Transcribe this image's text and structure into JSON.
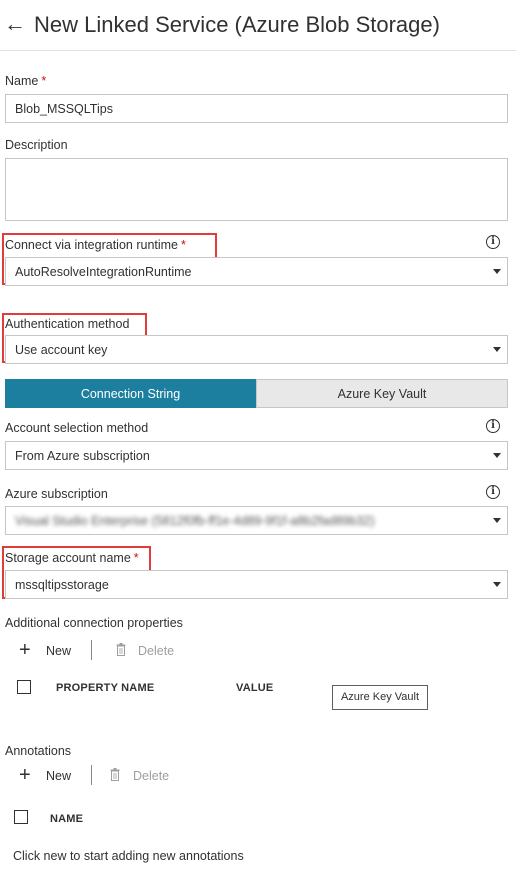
{
  "header": {
    "back_icon": "arrow-left-icon",
    "title": "New Linked Service (Azure Blob Storage)"
  },
  "name": {
    "label": "Name",
    "required_mark": "*",
    "value": "Blob_MSSQLTips"
  },
  "description": {
    "label": "Description",
    "value": ""
  },
  "integration_runtime": {
    "label": "Connect via integration runtime",
    "required_mark": "*",
    "value": "AutoResolveIntegrationRuntime",
    "info_icon": "info-icon"
  },
  "authentication": {
    "label": "Authentication method",
    "value": "Use account key"
  },
  "tabs": [
    {
      "label": "Connection String",
      "active": true
    },
    {
      "label": "Azure Key Vault",
      "active": false
    }
  ],
  "account_selection": {
    "label": "Account selection method",
    "value": "From Azure subscription",
    "info_icon": "info-icon"
  },
  "subscription": {
    "label": "Azure subscription",
    "value": "Visual Studio Enterprise (5812f0fb-ff1e-4d89-9f1f-a8b2fad89b32)",
    "info_icon": "info-icon"
  },
  "storage_account": {
    "label": "Storage account name",
    "required_mark": "*",
    "value": "mssqltipsstorage"
  },
  "connection_properties": {
    "label": "Additional connection properties",
    "new_label": "New",
    "delete_label": "Delete",
    "columns": [
      "PROPERTY NAME",
      "VALUE"
    ],
    "akv_button": "Azure Key Vault"
  },
  "annotations": {
    "label": "Annotations",
    "new_label": "New",
    "delete_label": "Delete",
    "columns": [
      "NAME"
    ],
    "hint": "Click new to start adding new annotations"
  },
  "colors": {
    "highlight": "#e03c3c",
    "tab_active": "#1c7fa0",
    "required": "#c50f1f"
  }
}
